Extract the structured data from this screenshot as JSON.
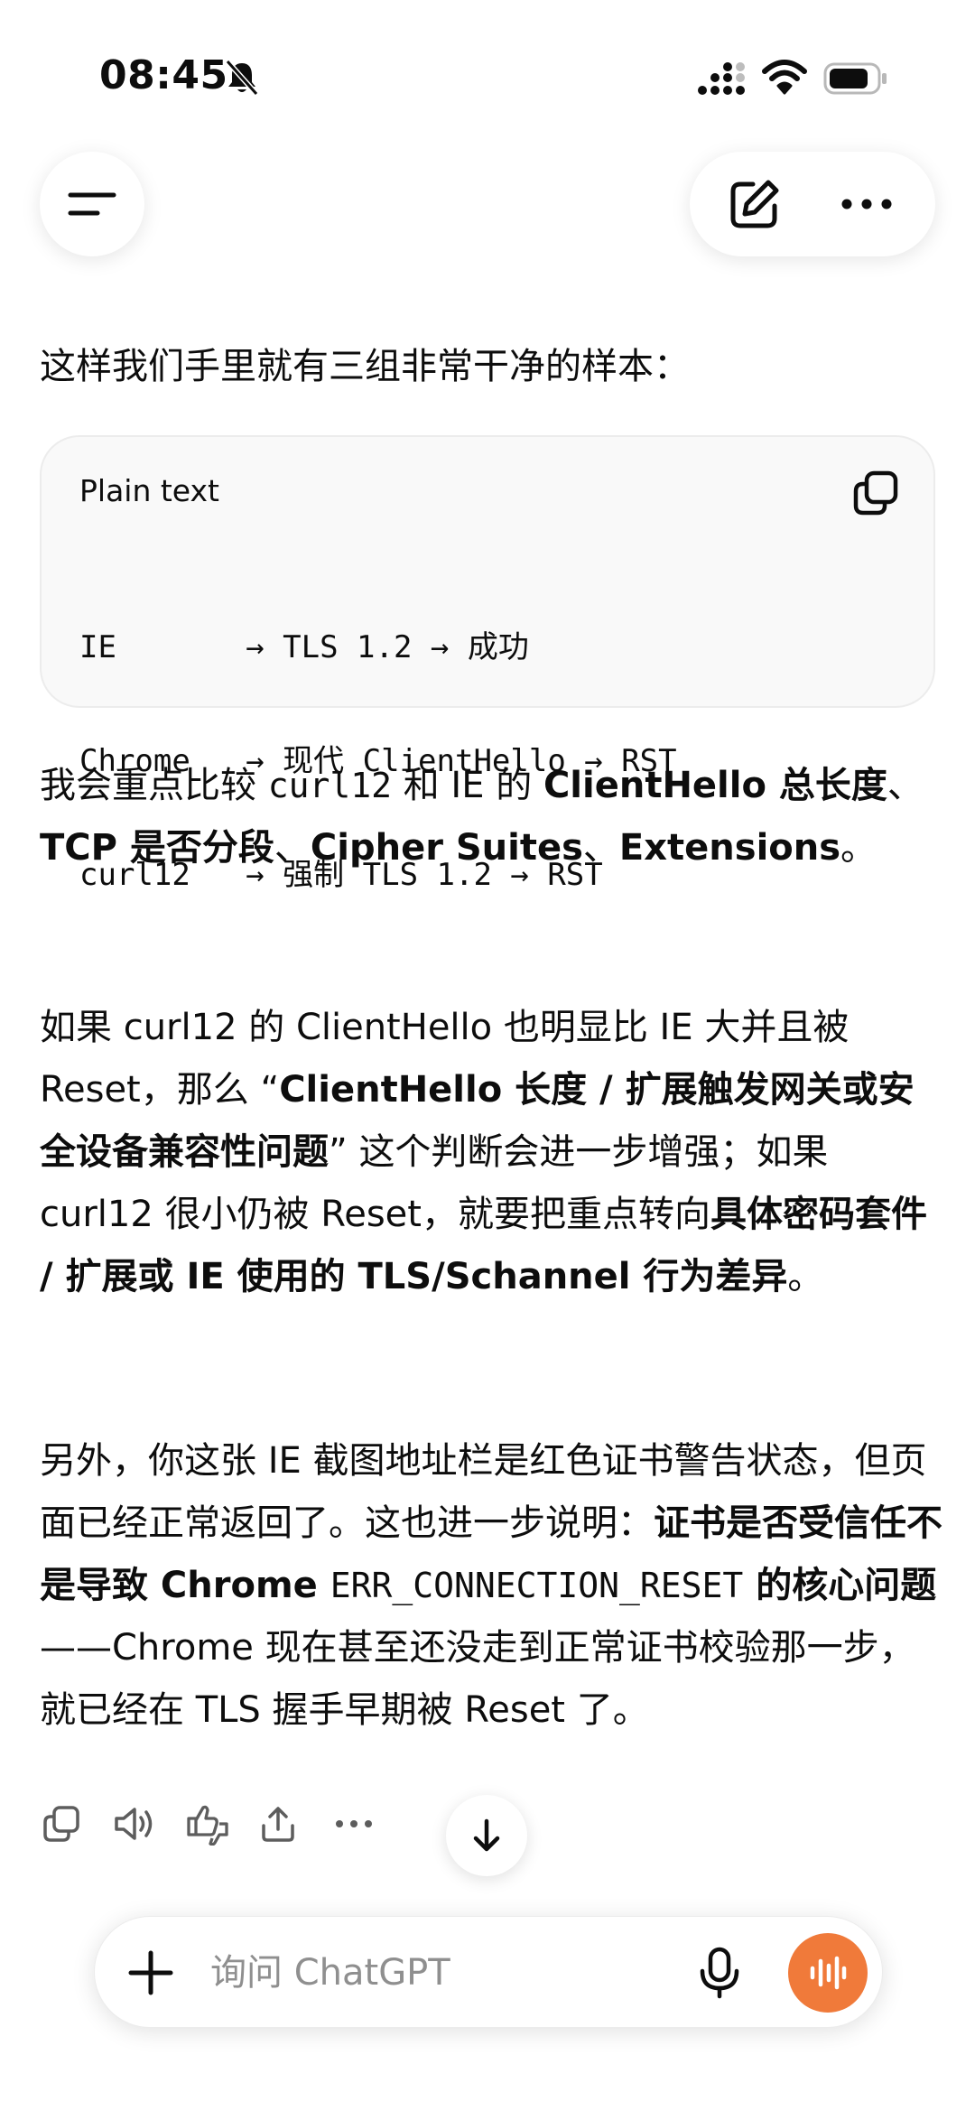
{
  "status_bar": {
    "time": "08:45",
    "icons": [
      "bell-slash-icon",
      "signal-icon",
      "wifi-icon",
      "battery-icon"
    ]
  },
  "nav": {
    "icons": [
      "menu-icon",
      "edit-icon",
      "more-icon"
    ]
  },
  "message": {
    "intro": "这样我们手里就有三组非常干净的样本：",
    "code_block": {
      "language": "Plain text",
      "lines": [
        "IE       → TLS 1.2 → 成功",
        "Chrome   → 现代 ClientHello → RST",
        "curl12   → 强制 TLS 1.2 → RST"
      ]
    },
    "p1": {
      "t1": "我会重点比较 ",
      "code1": "curl12",
      "t2": " 和 IE 的 ",
      "b1": "ClientHello 总长度",
      "t3": "、",
      "b2": "TCP 是否分段",
      "t4": "、",
      "b3": "Cipher Suites",
      "t5": "、",
      "b4": "Extensions",
      "t6": "。"
    },
    "p2": {
      "t1": "如果 curl12 的 ClientHello 也明显比 IE 大并且被 Reset，那么 “",
      "b1": "ClientHello 长度 / 扩展触发网关或安全设备兼容性问题",
      "t2": "” 这个判断会进一步增强；",
      "t3": "如果 curl12 很小仍被 Reset，就要把重点转向",
      "b2": "具体密码套件 / 扩展或 IE 使用的 TLS/Schannel 行为差异",
      "t4": "。"
    },
    "p3": {
      "t1": "另外，你这张 IE 截图地址栏是红色证书警告状态，但页面已经正常返回了。这也进一步说明：",
      "b1": "证书是否受信任不是导致 Chrome ",
      "code1": "ERR_CONNECTION_RESET",
      "b2": " 的核心问题",
      "t2": "——Chrome 现在甚至还没走到正常证书校验那一步，就已经在 TLS 握手早期被 Reset 了。"
    }
  },
  "actions": {
    "icons": [
      "copy-icon",
      "speaker-icon",
      "thumbs-feedback-icon",
      "share-icon",
      "more-icon"
    ]
  },
  "composer": {
    "placeholder": "询问 ChatGPT",
    "icons": [
      "plus-icon",
      "mic-icon",
      "voice-mode-icon"
    ]
  },
  "colors": {
    "text": "#0d0d0d",
    "placeholder": "#8f8f8f",
    "code_bg": "#f9f9f9",
    "voice_button": "#f07a3a"
  }
}
